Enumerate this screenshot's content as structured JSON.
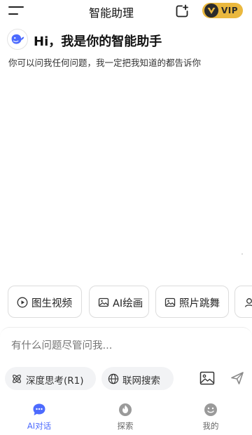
{
  "header": {
    "title": "智能助理",
    "vip_label": "VIP",
    "menu_icon": "menu-icon",
    "new_chat_icon": "new-chat-icon"
  },
  "greeting": {
    "title": "Hi，我是你的智能助手",
    "description": "你可以问我任何问题，我一定把我知道的都告诉你",
    "avatar_icon": "whale-logo-icon"
  },
  "suggestions": [
    {
      "label": "图生视频",
      "icon": "play-circle-icon"
    },
    {
      "label": "AI绘画",
      "icon": "image-icon"
    },
    {
      "label": "照片跳舞",
      "icon": "photo-icon"
    },
    {
      "label": "",
      "icon": "person-icon"
    }
  ],
  "composer": {
    "placeholder": "有什么问题尽管问我...",
    "deep_think_label": "深度思考(R1)",
    "web_search_label": "联网搜索",
    "image_icon": "image-upload-icon",
    "send_icon": "send-icon"
  },
  "bottom_nav": [
    {
      "label": "AI对话",
      "icon": "chat-bubble-icon",
      "active": true
    },
    {
      "label": "探索",
      "icon": "explore-hot-icon",
      "active": false
    },
    {
      "label": "我的",
      "icon": "smiley-icon",
      "active": false
    }
  ],
  "colors": {
    "accent": "#4d6bfe",
    "vip_gold": "#eab83e",
    "pill_bg": "#f2f3f5",
    "placeholder": "#8c8c8c"
  }
}
